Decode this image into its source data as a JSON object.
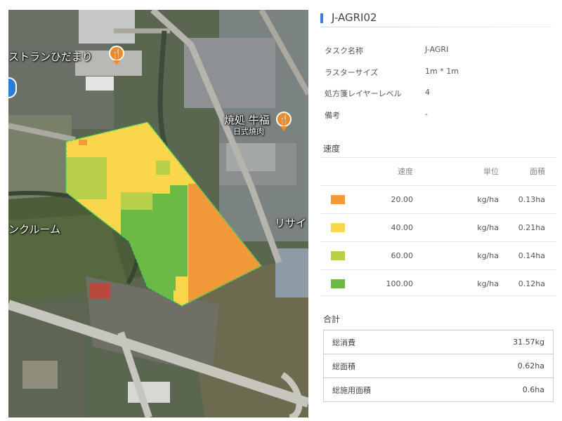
{
  "map": {
    "labels": {
      "restaurant": "ストランひだまり",
      "yakiniku_top": "焼処 牛福",
      "yakiniku_sub": "日式燒肉",
      "room": "ンクルーム",
      "recycle": "リサイ"
    },
    "icons": [
      "fork-knife-icon",
      "fork-knife-icon",
      "location-icon"
    ],
    "zones": [
      {
        "rate": "20.00",
        "color": "#f2993a"
      },
      {
        "rate": "40.00",
        "color": "#f9d64b"
      },
      {
        "rate": "60.00",
        "color": "#b8cf4a"
      },
      {
        "rate": "100.00",
        "color": "#6cba45"
      }
    ]
  },
  "panel": {
    "title": "J-AGRI02",
    "info": [
      {
        "label": "タスク名称",
        "value": "J-AGRI"
      },
      {
        "label": "ラスターサイズ",
        "value": "1m * 1m"
      },
      {
        "label": "処方箋レイヤーレベル",
        "value": "4"
      },
      {
        "label": "備考",
        "value": "-"
      }
    ],
    "rate_section": "速度",
    "rate_headers": {
      "rate": "速度",
      "unit": "単位",
      "area": "面積"
    },
    "rates": [
      {
        "color": "#f2993a",
        "rate": "20.00",
        "unit": "kg/ha",
        "area": "0.13ha"
      },
      {
        "color": "#f9d64b",
        "rate": "40.00",
        "unit": "kg/ha",
        "area": "0.21ha"
      },
      {
        "color": "#b8cf4a",
        "rate": "60.00",
        "unit": "kg/ha",
        "area": "0.14ha"
      },
      {
        "color": "#6cba45",
        "rate": "100.00",
        "unit": "kg/ha",
        "area": "0.12ha"
      }
    ],
    "totals_section": "合計",
    "totals": [
      {
        "label": "総消費",
        "value": "31.57kg"
      },
      {
        "label": "総面積",
        "value": "0.62ha"
      },
      {
        "label": "総施用面積",
        "value": "0.6ha"
      }
    ]
  }
}
